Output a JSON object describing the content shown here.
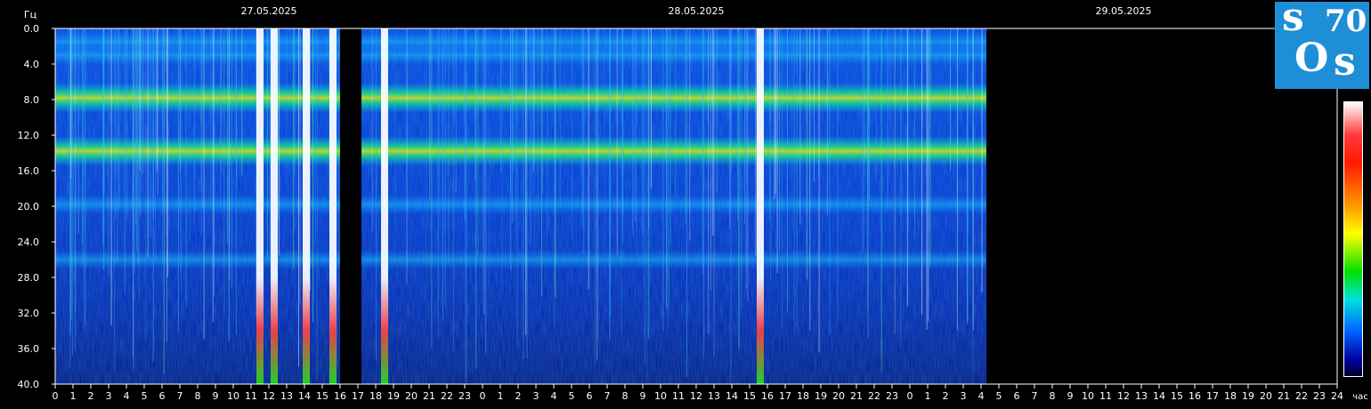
{
  "chart_data": {
    "type": "heatmap",
    "ylabel": "Гц",
    "xlabel": "час",
    "y_ticks": [
      "0.0",
      "4.0",
      "8.0",
      "12.0",
      "16.0",
      "20.0",
      "24.0",
      "28.0",
      "32.0",
      "36.0",
      "40.0"
    ],
    "ylim": [
      0,
      40
    ],
    "dates": [
      "27.05.2025",
      "28.05.2025",
      "29.05.2025"
    ],
    "x_ticks": [
      "0",
      "1",
      "2",
      "3",
      "4",
      "5",
      "6",
      "7",
      "8",
      "9",
      "10",
      "11",
      "12",
      "13",
      "14",
      "15",
      "16",
      "17",
      "18",
      "19",
      "20",
      "21",
      "22",
      "23",
      "0",
      "1",
      "2",
      "3",
      "4",
      "5",
      "6",
      "7",
      "8",
      "9",
      "10",
      "11",
      "12",
      "13",
      "14",
      "15",
      "16",
      "17",
      "18",
      "19",
      "20",
      "21",
      "22",
      "23",
      "0",
      "1",
      "2",
      "3",
      "4",
      "5",
      "6",
      "7",
      "8",
      "9",
      "10",
      "11",
      "12",
      "13",
      "14",
      "15",
      "16",
      "17",
      "18",
      "19",
      "20",
      "21",
      "22",
      "23",
      "24"
    ],
    "xlim_hours": [
      0,
      72
    ],
    "data_end_hour": 52.3,
    "data_gap_hours": [
      16.0,
      17.2
    ],
    "resonance_bands_hz": [
      1.5,
      3.0,
      7.8,
      13.8,
      19.8,
      26.0
    ],
    "bright_bursts_hours": [
      11.5,
      12.3,
      14.1,
      15.6,
      18.5,
      39.6
    ],
    "colorscale": [
      "#000030",
      "#0000a0",
      "#0060ff",
      "#00e0e0",
      "#00e000",
      "#ffff00",
      "#ff9a00",
      "#ff1a00",
      "#ff3a3a",
      "#ffffff"
    ]
  },
  "logo": {
    "s1": "s",
    "num": "70",
    "o": "O",
    "s2": "s"
  }
}
